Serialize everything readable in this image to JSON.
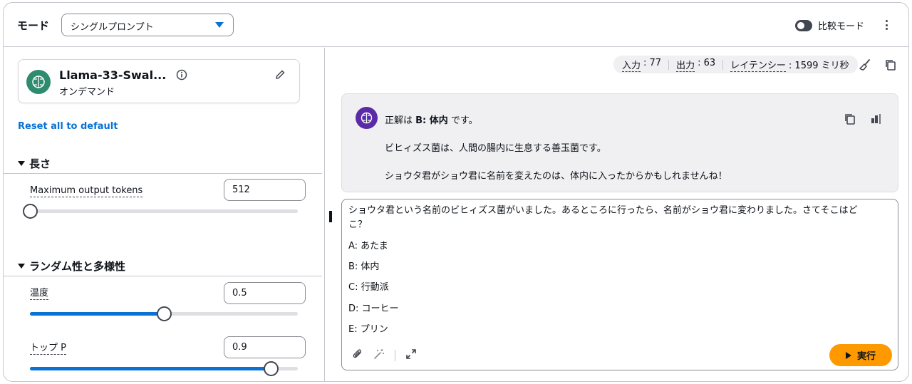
{
  "header": {
    "mode_label": "モード",
    "mode_value": "シングルプロンプト",
    "compare_label": "比較モード"
  },
  "model": {
    "name": "Llama-33-Swal...",
    "subtitle": "オンデマンド"
  },
  "reset_label": "Reset all to default",
  "sections": {
    "length": "長さ",
    "randomness": "ランダム性と多様性"
  },
  "params": {
    "max_tokens": {
      "label": "Maximum output tokens",
      "value": "512",
      "slider_fraction": 0.0
    },
    "temperature": {
      "label": "温度",
      "value": "0.5",
      "slider_fraction": 0.5
    },
    "top_p": {
      "label": "トップ P",
      "value": "0.9",
      "slider_fraction": 0.9
    }
  },
  "metrics": {
    "input_label": "入力",
    "input_value": ": 77",
    "output_label": "出力",
    "output_value": ": 63",
    "latency_label": "レイテンシー",
    "latency_value": ": 1599 ミリ秒"
  },
  "response": {
    "line1_prefix": "正解は ",
    "line1_bold": "B: 体内",
    "line1_suffix": " です。",
    "line2": "ビヒィズス菌は、人間の腸内に生息する善玉菌です。",
    "line3": "ショウタ君がショウ君に名前を変えたのは、体内に入ったからかもしれませんね！"
  },
  "prompt": {
    "line1": "ショウタ君という名前のビヒィズス菌がいました。あるところに行ったら、名前がショウ君に変わりました。さてそこはど",
    "line2": "こ？",
    "options": [
      "A: あたま",
      "B: 体内",
      "C: 行動派",
      "D: コーヒー",
      "E: プリン"
    ],
    "run_label": "実行"
  },
  "icons": {
    "model_avatar": "brain-circuit-icon",
    "info": "info-icon",
    "edit": "pencil-icon",
    "brush": "brush-icon",
    "copy": "copy-icon",
    "stats": "bar-chart-icon",
    "attach": "paperclip-icon",
    "magic": "magic-wand-icon",
    "expand": "expand-icon"
  },
  "colors": {
    "accent": "#0972d3",
    "run_button": "#ff9900",
    "model_avatar": "#2e8b6e",
    "response_avatar": "#5a2ba6"
  }
}
